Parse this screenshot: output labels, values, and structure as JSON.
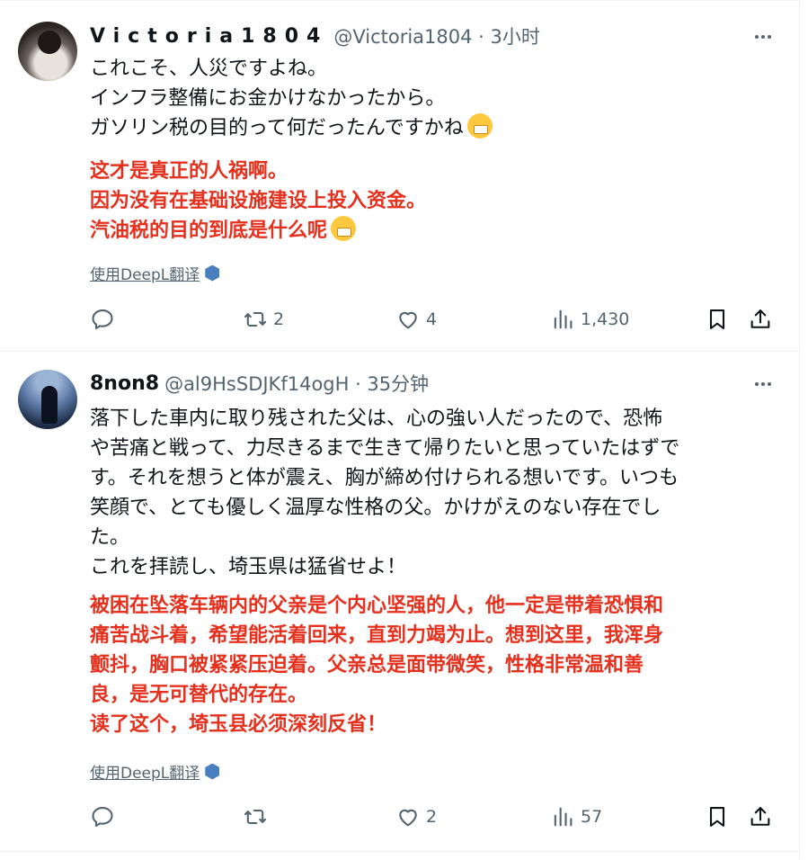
{
  "tweets": [
    {
      "author_name": "Victoria1804",
      "handle_time": "@Victoria1804 · 3小时",
      "original_lines": [
        "これこそ、人災ですよね。",
        "インフラ整備にお金かけなかったから。",
        "ガソリン税の目的って何だったんですかね"
      ],
      "translation_lines": [
        "这才是真正的人祸啊。",
        "因为没有在基础设施建设上投入资金。",
        "汽油税的目的到底是什么呢"
      ],
      "deepl_label": "使用DeepL翻译",
      "stats": {
        "replies": "",
        "retweets": "2",
        "likes": "4",
        "views": "1,430"
      }
    },
    {
      "author_name": "8non8",
      "handle_time": "@al9HsSDJKf14ogH · 35分钟",
      "original_lines": [
        "落下した車内に取り残された父は、心の強い人だったので、恐怖",
        "や苦痛と戦って、力尽きるまで生きて帰りたいと思っていたはずで",
        "す。それを想うと体が震え、胸が締め付けられる想いです。いつも",
        "笑顔で、とても優しく温厚な性格の父。かけがえのない存在でし",
        "た。",
        "これを拝読し、埼玉県は猛省せよ！"
      ],
      "translation_lines": [
        "被困在坠落车辆内的父亲是个内心坚强的人，他一定是带着恐惧和",
        "痛苦战斗着，希望能活着回来，直到力竭为止。想到这里，我浑身",
        "颤抖，胸口被紧紧压迫着。父亲总是面带微笑，性格非常温和善",
        "良，是无可替代的存在。",
        "读了这个，埼玉县必须深刻反省！"
      ],
      "deepl_label": "使用DeepL翻译",
      "stats": {
        "replies": "",
        "retweets": "",
        "likes": "2",
        "views": "57"
      }
    }
  ],
  "colors": {
    "translation": "#e5301d",
    "muted": "#536471",
    "divider": "#eff3f4"
  },
  "icons": [
    "more-icon",
    "reply-icon",
    "retweet-icon",
    "like-icon",
    "views-icon",
    "bookmark-icon",
    "share-icon",
    "deepl-icon",
    "face-with-steam-emoji"
  ]
}
